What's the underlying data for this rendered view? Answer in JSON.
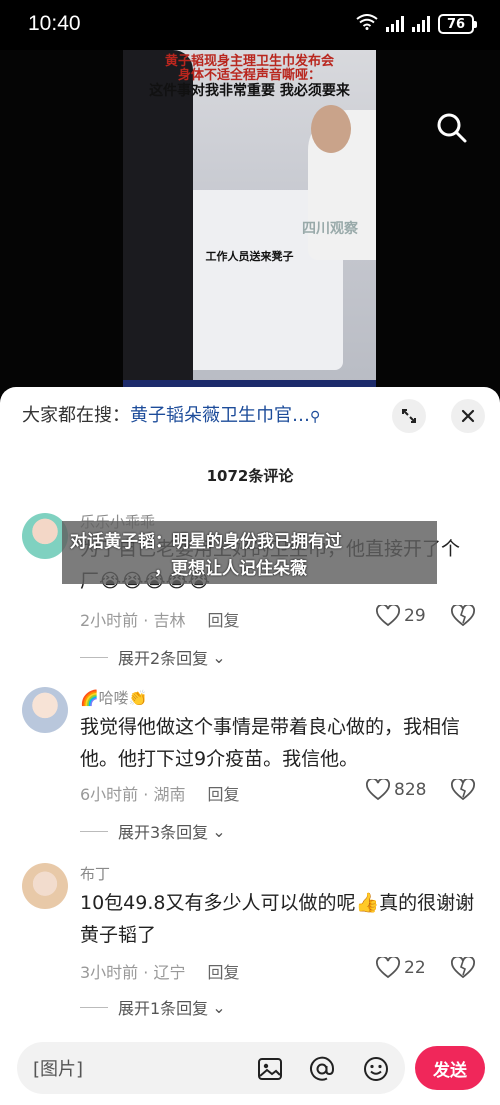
{
  "status_bar": {
    "time": "10:40",
    "battery": "76"
  },
  "video": {
    "caption_top": "黄子韬现身主理卫生巾发布会",
    "caption_red": "身体不适全程声音嘶哑：",
    "caption_main": "这件事对我非常重要 我必须要来",
    "caption_mid": "工作人员送来凳子",
    "logo": "四川观察"
  },
  "banner": {
    "line1": "对话黄子韬：明星的身份我已拥有过",
    "line2": "，更想让人记住朵薇"
  },
  "panel": {
    "suggest_prefix": "大家都在搜：",
    "suggest_link": "黄子韬朵薇卫生巾官…",
    "comment_count": "1072条评论"
  },
  "comments": [
    {
      "user": "乐乐小乖乖",
      "text": "为了自己老婆用上好的卫生巾，他直接开了个厂😭😭😭😭😭",
      "time": "2小时前",
      "location": "吉林",
      "reply": "回复",
      "likes": "29",
      "expand": "展开2条回复"
    },
    {
      "user": "🌈哈喽👏",
      "text": "我觉得他做这个事情是带着良心做的，我相信他。他打下过9介疫苗。我信他。",
      "time": "6小时前",
      "location": "湖南",
      "reply": "回复",
      "likes": "828",
      "expand": "展开3条回复"
    },
    {
      "user": "布丁",
      "text": "10包49.8又有多少人可以做的呢👍真的很谢谢黄子韬了",
      "time": "3小时前",
      "location": "辽宁",
      "reply": "回复",
      "likes": "22",
      "expand": "展开1条回复"
    }
  ],
  "input_bar": {
    "placeholder": "[图片]",
    "send_label": "发送"
  },
  "colors": {
    "accent": "#f0275a",
    "link": "#1d4c9a"
  }
}
